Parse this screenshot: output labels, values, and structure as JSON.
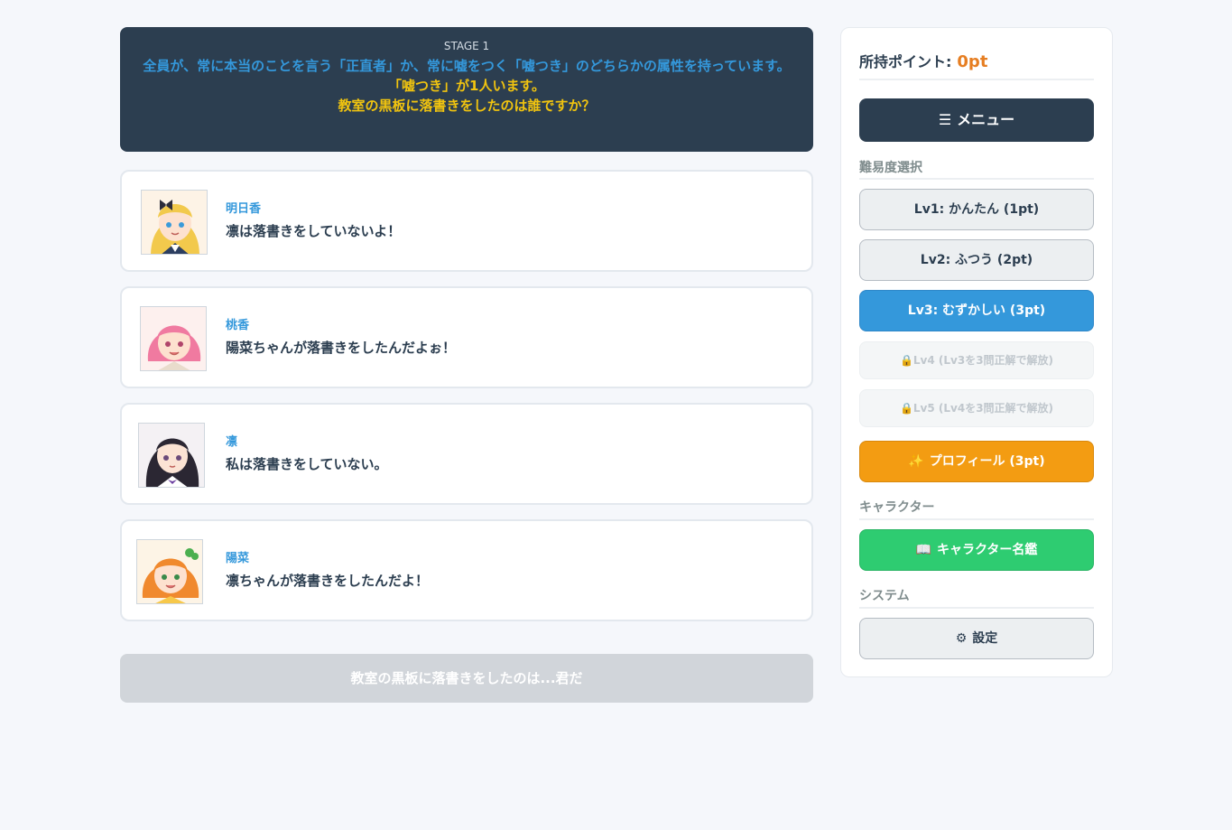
{
  "question": {
    "stage": "STAGE 1",
    "line1": "全員が、常に本当のことを言う「正直者」か、常に嘘をつく「嘘つき」のどちらかの属性を持っています。",
    "line2": "「嘘つき」が1人います。",
    "line3": "教室の黒板に落書きをしたのは誰ですか？"
  },
  "characters": [
    {
      "name": "明日香",
      "statement": "凛は落書きをしていないよ！",
      "hair_color": "#f2c94c"
    },
    {
      "name": "桃香",
      "statement": "陽菜ちゃんが落書きをしたんだよぉ！",
      "hair_color": "#f07aa0"
    },
    {
      "name": "凛",
      "statement": "私は落書きをしていない。",
      "hair_color": "#2b2733"
    },
    {
      "name": "陽菜",
      "statement": "凛ちゃんが落書きをしたんだよ！",
      "hair_color": "#f0892e"
    }
  ],
  "answer_button": "教室の黒板に落書きをしたのは...君だ",
  "sidebar": {
    "points_label": "所持ポイント:",
    "points_value": "0pt",
    "menu_icon": "☰",
    "menu_label": "メニュー",
    "difficulty_heading": "難易度選択",
    "levels": [
      {
        "label": "Lv1: かんたん (1pt)",
        "state": "normal"
      },
      {
        "label": "Lv2: ふつう (2pt)",
        "state": "normal"
      },
      {
        "label": "Lv3: むずかしい (3pt)",
        "state": "selected"
      },
      {
        "label": "Lv4 (Lv3を3問正解で解放)",
        "state": "locked"
      },
      {
        "label": "Lv5 (Lv4を3問正解で解放)",
        "state": "locked"
      }
    ],
    "lock_icon": "🔒",
    "profile_label": "プロフィール (3pt)",
    "profile_icon": "✨",
    "character_heading": "キャラクター",
    "dictionary_label": "キャラクター名鑑",
    "dictionary_icon": "📖",
    "system_heading": "システム",
    "settings_label": "設定",
    "settings_icon": "⚙"
  },
  "colors": {
    "accent_blue": "#3498db",
    "dark_navy": "#2c3e50",
    "points_orange": "#e67e22",
    "profile_orange": "#f39c12",
    "dictionary_green": "#2ecc71",
    "question_yellow": "#f1c40f"
  }
}
